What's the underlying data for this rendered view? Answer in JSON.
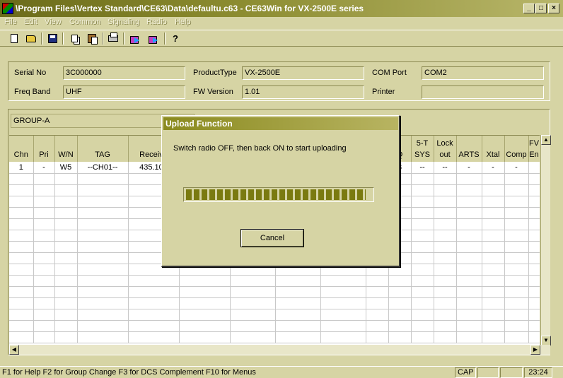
{
  "window": {
    "title": "\\Program Files\\Vertex Standard\\CE63\\Data\\defaultu.c63 - CE63Win for VX-2500E series"
  },
  "menu": [
    "File",
    "Edit",
    "View",
    "Common",
    "Signaling",
    "Radio",
    "Help"
  ],
  "toolbar": {
    "icons": [
      "new-file-icon",
      "open-folder-icon",
      "save-disk-icon",
      "copy-icon",
      "paste-icon",
      "print-icon",
      "read-from-radio-icon",
      "write-to-radio-icon",
      "help-icon"
    ],
    "help_glyph": "?"
  },
  "info": {
    "serial_no": {
      "label": "Serial No",
      "value": "3C000000"
    },
    "product_type": {
      "label": "ProductType",
      "value": "VX-2500E"
    },
    "com_port": {
      "label": "COM Port",
      "value": "COM2"
    },
    "freq_band": {
      "label": "Freq Band",
      "value": "UHF"
    },
    "fw_version": {
      "label": "FW Version",
      "value": "1.01"
    },
    "printer": {
      "label": "Printer",
      "value": ""
    }
  },
  "group": {
    "name": "GROUP-A"
  },
  "grid": {
    "headers": [
      {
        "l1": "",
        "l2": "Chn"
      },
      {
        "l1": "",
        "l2": "Pri"
      },
      {
        "l1": "",
        "l2": "W/N"
      },
      {
        "l1": "",
        "l2": "TAG"
      },
      {
        "l1": "",
        "l2": "Receive"
      },
      {
        "l1": "",
        "l2": ""
      },
      {
        "l1": "",
        "l2": ""
      },
      {
        "l1": "",
        "l2": ""
      },
      {
        "l1": "",
        "l2": ""
      },
      {
        "l1": "",
        "l2": ""
      },
      {
        "l1": "",
        "l2": "Q"
      },
      {
        "l1": "5-T",
        "l2": "SYS"
      },
      {
        "l1": "Lock",
        "l2": "out"
      },
      {
        "l1": "",
        "l2": "ARTS"
      },
      {
        "l1": "",
        "l2": "Xtal"
      },
      {
        "l1": "",
        "l2": "Comp"
      },
      {
        "l1": "FV",
        "l2": "En"
      }
    ],
    "rows": [
      [
        "1",
        "-",
        "W5",
        "--CH01--",
        "435.100",
        "",
        "",
        "",
        "",
        "",
        "3",
        "--",
        "--",
        "-",
        "-",
        "-",
        ""
      ]
    ]
  },
  "dialog": {
    "title": "Upload Function",
    "message": "Switch radio OFF, then back ON to start uploading",
    "progress_fraction": 0.97,
    "cancel_label": "Cancel"
  },
  "status": {
    "hints": "F1 for Help   F2 for Group Change   F3 for DCS Complement   F10 for Menus",
    "caps": "CAP",
    "clock": "23:24"
  }
}
